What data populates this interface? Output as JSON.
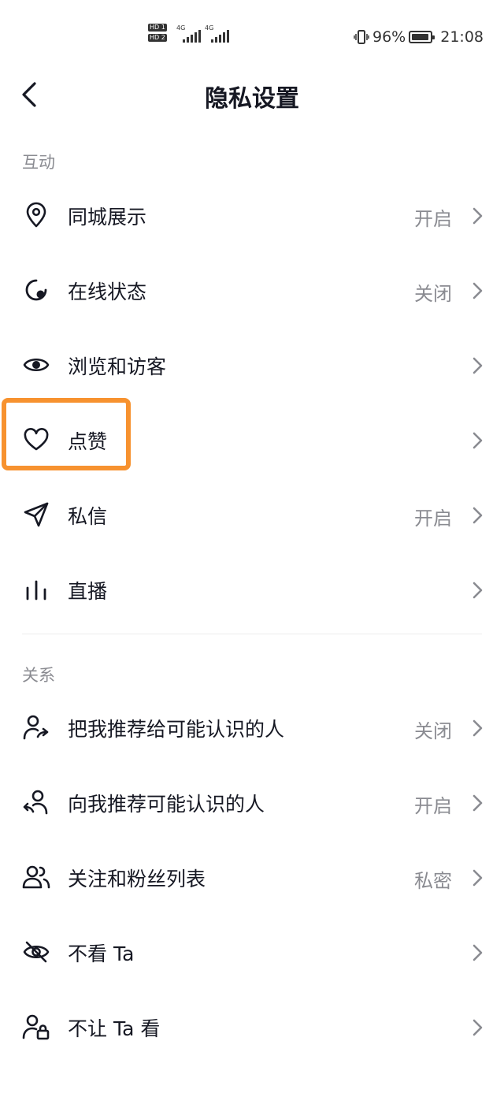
{
  "status_bar": {
    "sim1_label": "HD 1",
    "sim2_label": "HD 2",
    "network1": "4G",
    "network2": "4G",
    "battery_percent": "96%",
    "battery_level": 0.96,
    "time": "21:08"
  },
  "header": {
    "title": "隐私设置",
    "back_icon": "chevron-left-icon"
  },
  "sections": [
    {
      "label": "互动",
      "items": [
        {
          "label": "同城展示",
          "value": "开启",
          "icon": "location-pin-icon"
        },
        {
          "label": "在线状态",
          "value": "关闭",
          "icon": "online-status-icon"
        },
        {
          "label": "浏览和访客",
          "value": "",
          "icon": "eye-icon"
        },
        {
          "label": "点赞",
          "value": "",
          "icon": "heart-icon",
          "highlighted": true
        },
        {
          "label": "私信",
          "value": "开启",
          "icon": "send-icon"
        },
        {
          "label": "直播",
          "value": "",
          "icon": "live-bars-icon"
        }
      ]
    },
    {
      "label": "关系",
      "items": [
        {
          "label": "把我推荐给可能认识的人",
          "value": "关闭",
          "icon": "user-share-icon"
        },
        {
          "label": "向我推荐可能认识的人",
          "value": "开启",
          "icon": "user-recommend-icon"
        },
        {
          "label": "关注和粉丝列表",
          "value": "私密",
          "icon": "users-icon"
        },
        {
          "label": "不看 Ta",
          "value": "",
          "icon": "eye-off-icon"
        },
        {
          "label": "不让 Ta 看",
          "value": "",
          "icon": "user-lock-icon"
        }
      ]
    }
  ],
  "colors": {
    "highlight": "#f7922f",
    "text_primary": "#161823",
    "text_secondary": "#8a8b91"
  }
}
